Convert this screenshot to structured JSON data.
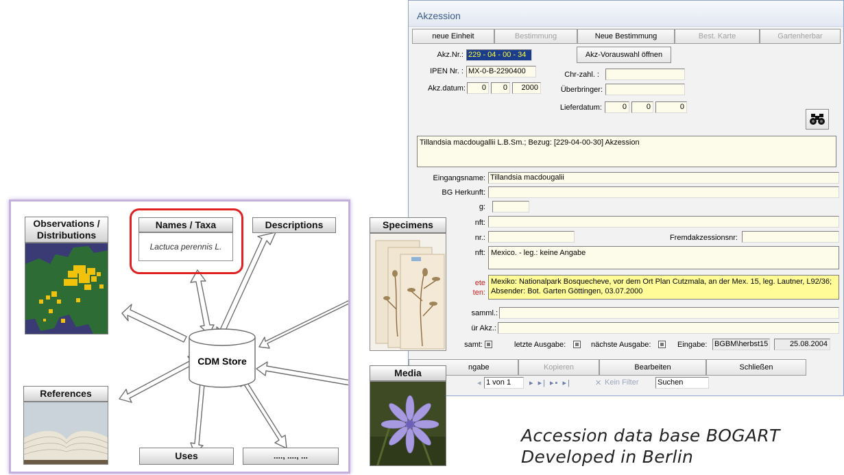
{
  "window": {
    "title": "Akzession",
    "tabs": [
      {
        "label": "neue Einheit",
        "enabled": true
      },
      {
        "label": "Bestimmung",
        "enabled": false
      },
      {
        "label": "Neue Bestimmung",
        "enabled": true
      },
      {
        "label": "Best. Karte",
        "enabled": false
      },
      {
        "label": "Gartenherbar",
        "enabled": false
      }
    ],
    "akz_nr_label": "Akz.Nr.:",
    "akz_nr_value": "229 - 04 - 00 - 34",
    "vorauswahl_button": "Akz-Vorauswahl öffnen",
    "ipen_label": "IPEN Nr. :",
    "ipen_value": "MX-0-B-2290400",
    "chr_label": "Chr-zahl. :",
    "chr_value": "",
    "akz_datum_label": "Akz.datum:",
    "akz_datum_day": "0",
    "akz_datum_month": "0",
    "akz_datum_year": "2000",
    "ueberbringer_label": "Überbringer:",
    "ueberbringer_value": "",
    "lieferdatum_label": "Lieferdatum:",
    "lieferdatum_day": "0",
    "lieferdatum_month": "0",
    "lieferdatum_year": "0",
    "summary": "Tillandsia macdougallii L.B.Sm.;  Bezug: [229-04-00-30] Akzession",
    "eingangsname_label": "Eingangsname:",
    "eingangsname_value": "Tillandsia macdougalii",
    "bg_herkunft_label": "BG Herkunft:",
    "bg_herkunft_value": "",
    "row3_label": "g:",
    "row4_label": "nft:",
    "row5_label": "nr.:",
    "fremdakzession_label": "Fremdakzessionsnr:",
    "fremdakzession_value": "",
    "herkunft_label": "nft:",
    "herkunft_value": "Mexico. - leg.: keine Angabe",
    "red_label_1": "ete",
    "red_label_2": "ten:",
    "fundort_value": "Mexiko: Nationalpark Bosquecheve, vor dem Ort Plan Cutzmala, an der Mex. 15, leg. Lautner, L92/36; Absender: Bot. Garten Göttingen, 03.07.2000",
    "samml_label": "samml.:",
    "samml_value": "",
    "fuer_akz_label": "ür Akz.:",
    "fuer_akz_value": "",
    "gesamt_label": "samt:",
    "letzte_ausgabe_label": "letzte Ausgabe:",
    "naechste_ausgabe_label": "nächste Ausgabe:",
    "eingabe_label": "Eingabe:",
    "eingabe_user": "BGBM\\herbst15",
    "eingabe_date": "25.08.2004",
    "bottom_buttons": [
      {
        "label": "ngabe",
        "enabled": true
      },
      {
        "label": "Kopieren",
        "enabled": false
      },
      {
        "label": "Bearbeiten",
        "enabled": true
      },
      {
        "label": "Schließen",
        "enabled": true
      }
    ],
    "nav_record": "1 von 1",
    "nav_filter": "Kein Filter",
    "nav_search": "Suchen"
  },
  "diagram": {
    "center": "CDM Store",
    "observations": "Observations /\nDistributions",
    "names_title": "Names / Taxa",
    "names_example": "Lactuca perennis L.",
    "descriptions": "Descriptions",
    "specimens": "Specimens",
    "media": "Media",
    "references": "References",
    "uses": "Uses",
    "more": "...., ...., ..."
  },
  "caption_line1": "Accession data base BOGART",
  "caption_line2": "Developed in Berlin",
  "colors": {
    "window_bg": "#f2f2f2",
    "field_bg": "#fdfbe9",
    "highlight_field": "#ffff80",
    "diagram_border": "#c4b0dc",
    "names_highlight": "#e02020",
    "map_ocean": "#3a3a74",
    "map_land": "#2d6d35",
    "map_obs": "#f2c10a"
  }
}
